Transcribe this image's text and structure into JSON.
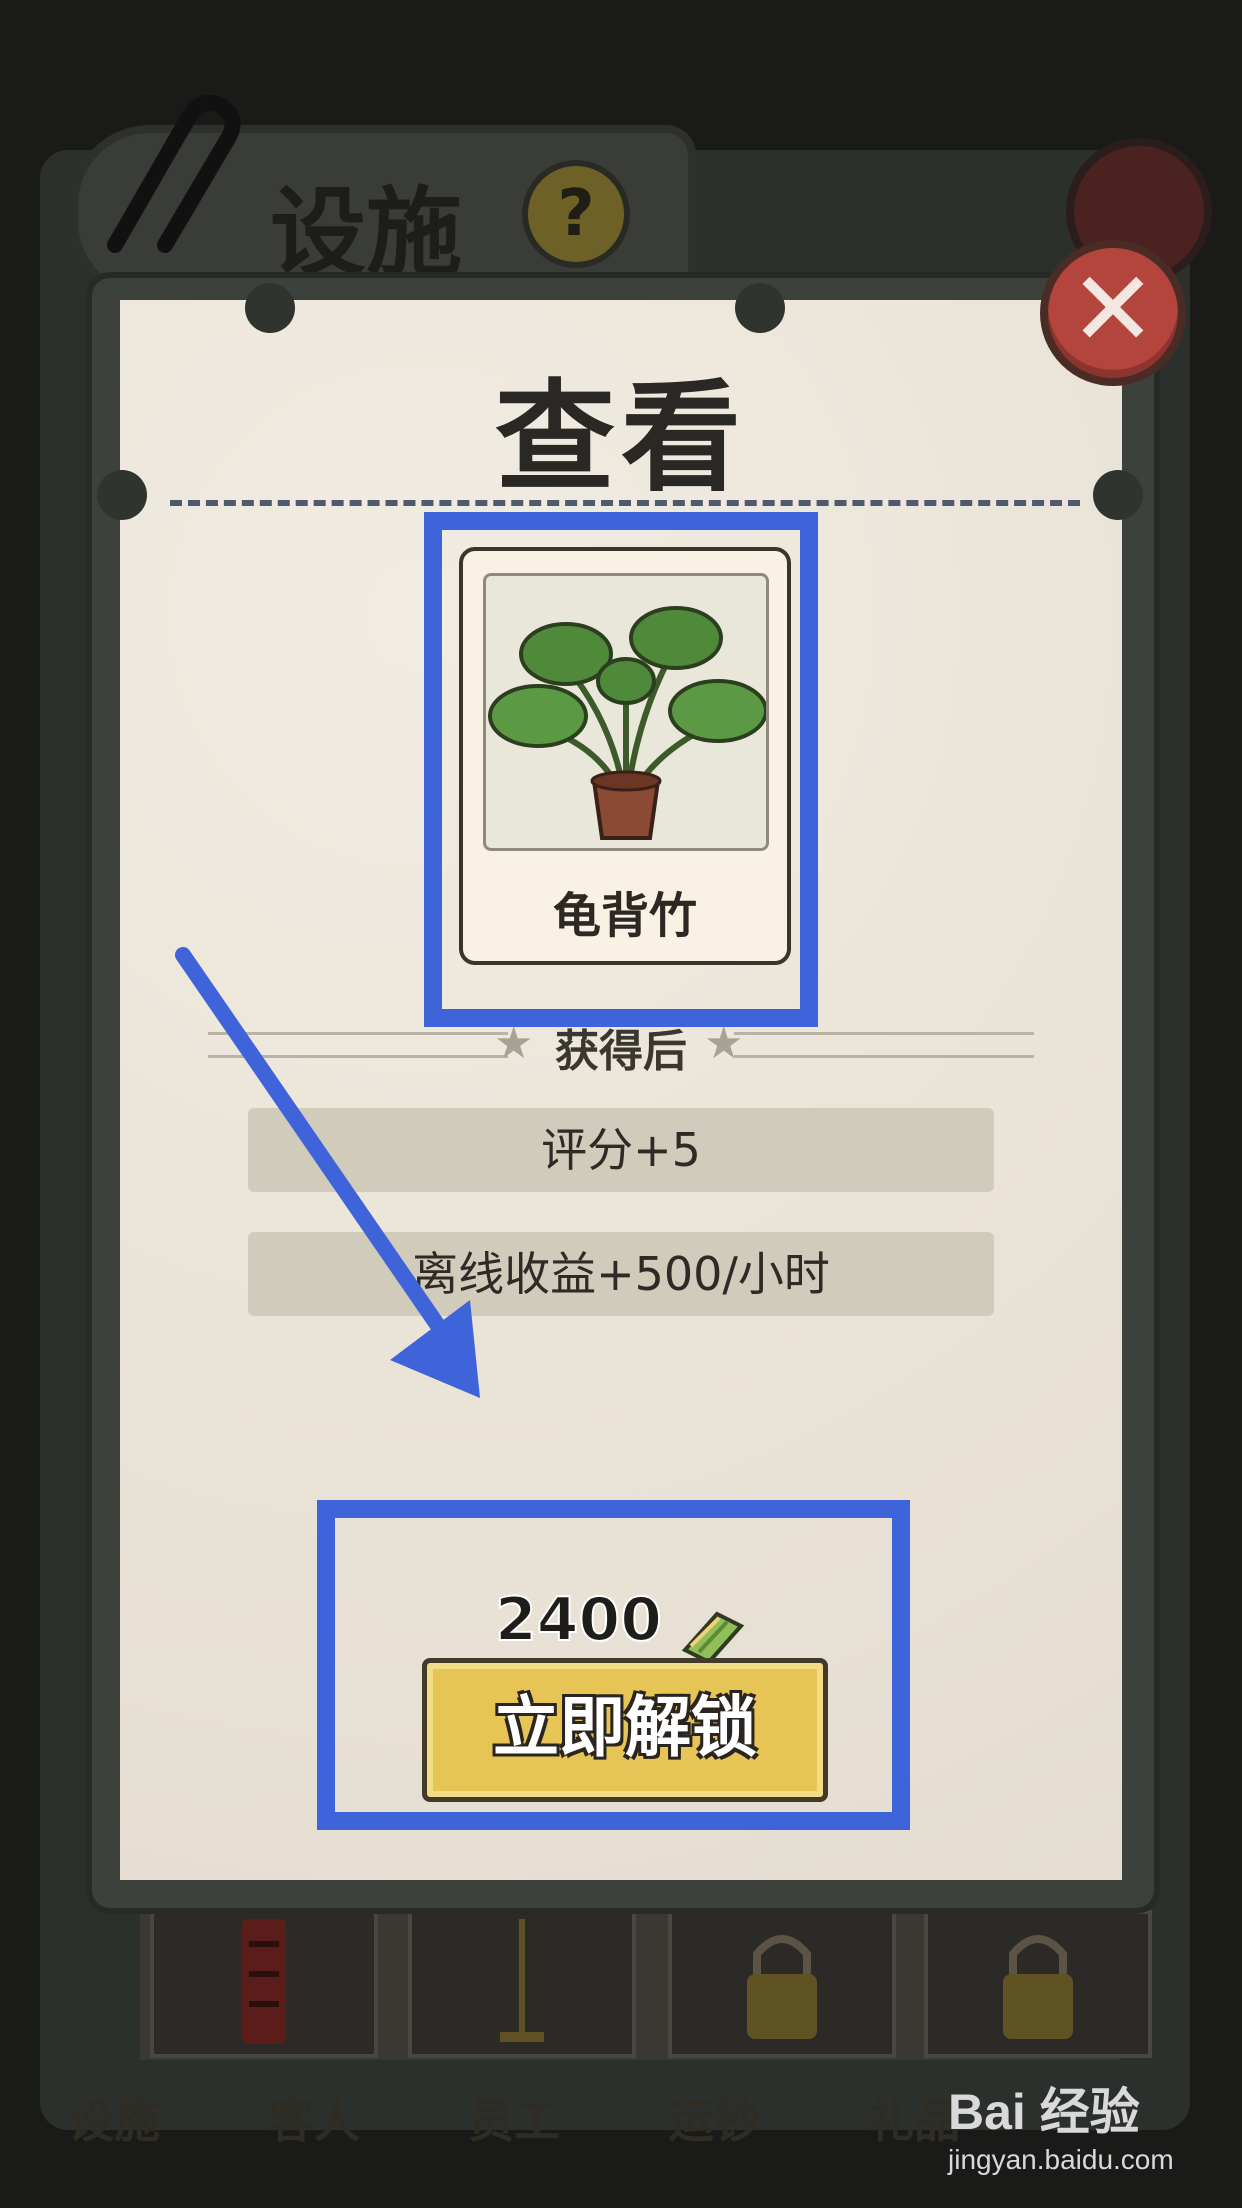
{
  "background": {
    "tab_title": "设施",
    "help_label": "?",
    "nav_tabs": [
      "设施",
      "客人",
      "员工",
      "运钞",
      "礼品"
    ]
  },
  "dialog": {
    "title": "查看",
    "close_label": "✕",
    "item": {
      "name": "龟背竹",
      "icon": "monstera-plant-icon"
    },
    "section_header": "获得后",
    "benefits": [
      "评分+5",
      "离线收益+500/小时"
    ],
    "price": "2400",
    "currency_icon": "cash-stack-icon",
    "unlock_label": "立即解锁"
  },
  "annotation": {
    "color": "#3f63d9"
  },
  "watermark": {
    "brand": "Bai 经验",
    "url": "jingyan.baidu.com"
  }
}
